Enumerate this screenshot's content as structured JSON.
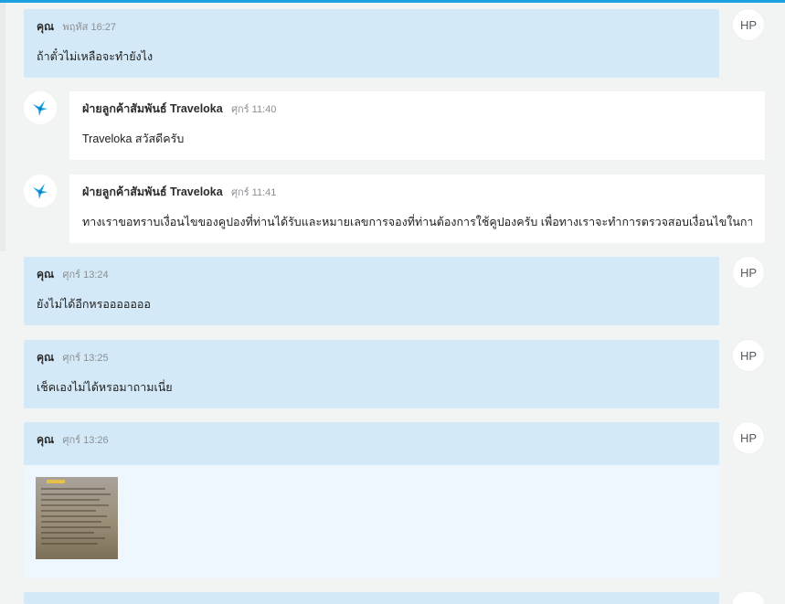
{
  "colors": {
    "accent": "#1ba0e2",
    "user_bubble": "#d3e9f7",
    "agent_bubble": "#ffffff",
    "image_panel": "#eef7fd",
    "background": "#f2f3f3"
  },
  "user_avatar": {
    "initials": "HP"
  },
  "agent_avatar": {
    "icon": "traveloka-bird-icon"
  },
  "messages": [
    {
      "sender": "คุณ",
      "time": "พฤหัส 16:27",
      "text": "ถ้าตั๋วไม่เหลือจะทำยังไง"
    },
    {
      "sender": "ฝ่ายลูกค้าสัมพันธ์ Traveloka",
      "time": "ศุกร์ 11:40",
      "text": "Traveloka สวัสดีครับ"
    },
    {
      "sender": "ฝ่ายลูกค้าสัมพันธ์ Traveloka",
      "time": "ศุกร์ 11:41",
      "text": "ทางเราขอทราบเงื่อนไขของคูปองที่ท่านได้รับและหมายเลขการจองที่ท่านต้องการใช้คูปองครับ เพื่อทางเราจะทำการตรวจสอบเงื่อนไขในการจอง"
    },
    {
      "sender": "คุณ",
      "time": "ศุกร์ 13:24",
      "text": "ยังไม่ได้อีกหรอออออออ"
    },
    {
      "sender": "คุณ",
      "time": "ศุกร์ 13:25",
      "text": "เช็คเองไม่ได้หรอมาถามเนี่ย"
    },
    {
      "sender": "คุณ",
      "time": "ศุกร์ 13:26",
      "attachment": "image-thumbnail"
    }
  ]
}
